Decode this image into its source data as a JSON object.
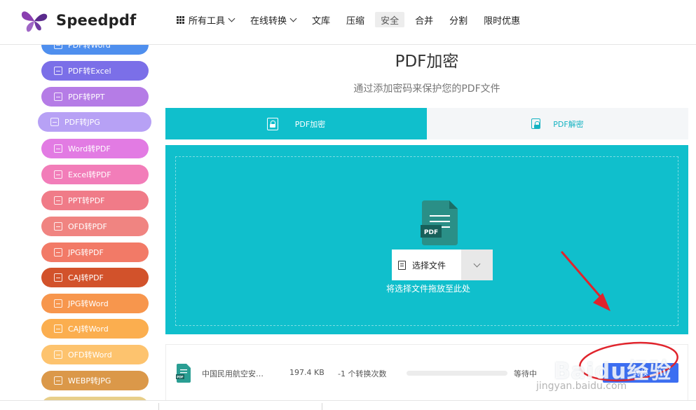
{
  "brand": {
    "name": "Speedpdf"
  },
  "nav": {
    "items": [
      {
        "label": "所有工具",
        "has_menu": true,
        "icon": "grid-icon"
      },
      {
        "label": "在线转换",
        "has_menu": true
      },
      {
        "label": "文库"
      },
      {
        "label": "压缩"
      },
      {
        "label": "安全",
        "active": true
      },
      {
        "label": "合并"
      },
      {
        "label": "分割"
      },
      {
        "label": "限时优惠"
      }
    ]
  },
  "sidebar": {
    "items": [
      {
        "label": "PDF转Word",
        "color": "#4f8fee"
      },
      {
        "label": "PDF转Excel",
        "color": "#7b6fe8"
      },
      {
        "label": "PDF转PPT",
        "color": "#b57ce6"
      },
      {
        "label": "PDF转JPG",
        "color": "#b7a1f5",
        "selected": true
      },
      {
        "label": "Word转PDF",
        "color": "#e27be3"
      },
      {
        "label": "Excel转PDF",
        "color": "#f27db9"
      },
      {
        "label": "PPT转PDF",
        "color": "#f07b88"
      },
      {
        "label": "OFD转PDF",
        "color": "#f08481"
      },
      {
        "label": "JPG转PDF",
        "color": "#f27a67"
      },
      {
        "label": "CAJ转PDF",
        "color": "#d2522b"
      },
      {
        "label": "JPG转Word",
        "color": "#f7964d"
      },
      {
        "label": "CAJ转Word",
        "color": "#fbae4f"
      },
      {
        "label": "OFD转Word",
        "color": "#fdc36e"
      },
      {
        "label": "WEBP转JPG",
        "color": "#db9849"
      },
      {
        "label": "",
        "color": "#e8cf8a"
      }
    ]
  },
  "main": {
    "title": "PDF加密",
    "subtitle": "通过添加密码来保护您的PDF文件",
    "tabs": [
      {
        "label": "PDF加密",
        "active": true,
        "icon": "lock-icon"
      },
      {
        "label": "PDF解密",
        "active": false,
        "icon": "unlock-icon"
      }
    ],
    "dropzone": {
      "choose_label": "选择文件",
      "hint": "将选择文件拖放至此处",
      "pdf_icon_text": "PDF"
    }
  },
  "file": {
    "name": "中国民用航空安…",
    "size": "197.4 KB",
    "count": "-1 个转换次数",
    "progress": 0,
    "status": "等待中",
    "action": "转换",
    "icon_text": "PDF"
  },
  "watermark": {
    "main": "Baidu经验",
    "sub": "jingyan.baidu.com"
  },
  "colors": {
    "accent": "#10bfcc",
    "tab_inactive_bg": "#f4f6f8",
    "convert_button": "#3c6ef2",
    "annotation_red": "#e0242c"
  }
}
